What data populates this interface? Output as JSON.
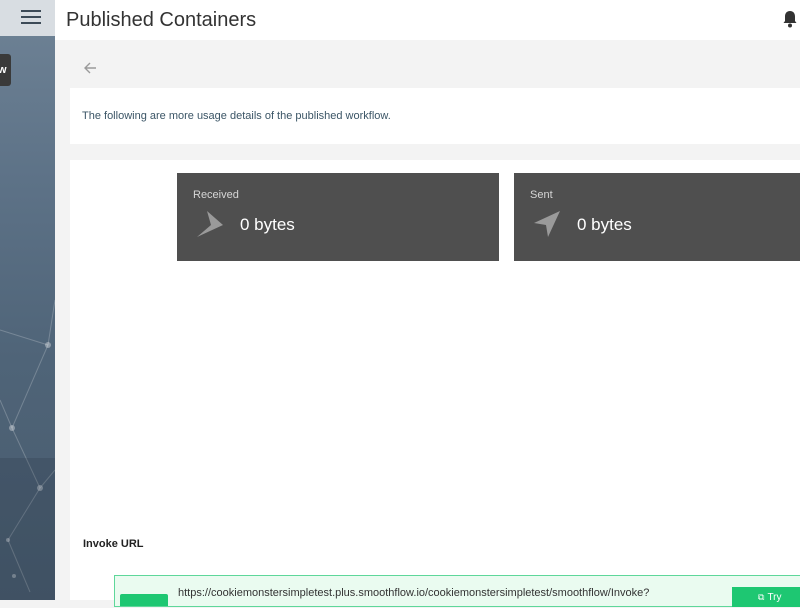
{
  "header": {
    "title": "Published Containers"
  },
  "sidebar": {
    "badge_text": "w"
  },
  "description": "The following are more usage details of the published workflow.",
  "stats": {
    "received": {
      "label": "Received",
      "value": "0 bytes"
    },
    "sent": {
      "label": "Sent",
      "value": "0 bytes"
    }
  },
  "invoke": {
    "label": "Invoke URL",
    "url": "https://cookiemonstersimpletest.plus.smoothflow.io/cookiemonstersimpletest/smoothflow/Invoke?",
    "try_label": "Try"
  },
  "icons": {
    "menu": "hamburger-menu-icon",
    "bell": "notification-bell-icon",
    "back": "arrow-left-icon",
    "received": "paper-plane-right-icon",
    "sent": "paper-plane-up-icon",
    "external": "external-link-icon"
  },
  "colors": {
    "card_bg": "#4f4f4f",
    "accent_green": "#1ec772",
    "url_bg": "#eafbf0"
  }
}
